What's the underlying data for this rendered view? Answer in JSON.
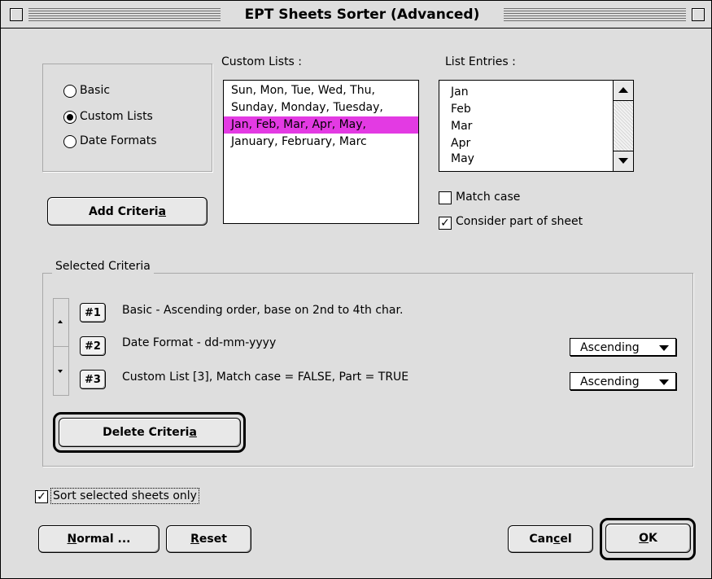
{
  "window": {
    "title": "EPT Sheets Sorter (Advanced)"
  },
  "sort_type": {
    "options": [
      "Basic",
      "Custom Lists",
      "Date Formats"
    ],
    "selected": "Custom Lists"
  },
  "custom_lists": {
    "label": "Custom Lists :",
    "items": [
      "Sun, Mon, Tue, Wed, Thu,",
      "Sunday, Monday, Tuesday,",
      "Jan, Feb, Mar, Apr, May,",
      "January, February, Marc"
    ],
    "selected_index": 2
  },
  "list_entries": {
    "label": "List Entries :",
    "items": [
      "Jan",
      "Feb",
      "Mar",
      "Apr",
      "May"
    ]
  },
  "options": {
    "match_case": {
      "label": "Match case",
      "checked": false
    },
    "consider_part": {
      "label": "Consider part of sheet",
      "checked": true
    }
  },
  "add_criteria": {
    "label_pre": "Add Criteri",
    "label_ul": "a"
  },
  "selected_criteria": {
    "label": "Selected Criteria",
    "rows": [
      {
        "num": "#1",
        "text": "Basic - Ascending order, base on 2nd to 4th char.",
        "order": ""
      },
      {
        "num": "#2",
        "text": "Date Format - dd-mm-yyyy",
        "order": "Ascending"
      },
      {
        "num": "#3",
        "text": "Custom List [3], Match case = FALSE, Part = TRUE",
        "order": "Ascending"
      }
    ]
  },
  "delete_criteria": {
    "label_pre": "Delete Criteri",
    "label_ul": "a"
  },
  "sort_selected_only": {
    "label": "Sort selected sheets only",
    "checked": true
  },
  "buttons": {
    "normal": {
      "ul": "N",
      "rest": "ormal ..."
    },
    "reset": {
      "ul": "R",
      "rest": "eset"
    },
    "cancel": {
      "pre": "Can",
      "ul": "c",
      "post": "el"
    },
    "ok": {
      "ul": "O",
      "rest": "K"
    }
  },
  "colors": {
    "selection": "#e33ae3",
    "window_bg": "#dedede"
  }
}
